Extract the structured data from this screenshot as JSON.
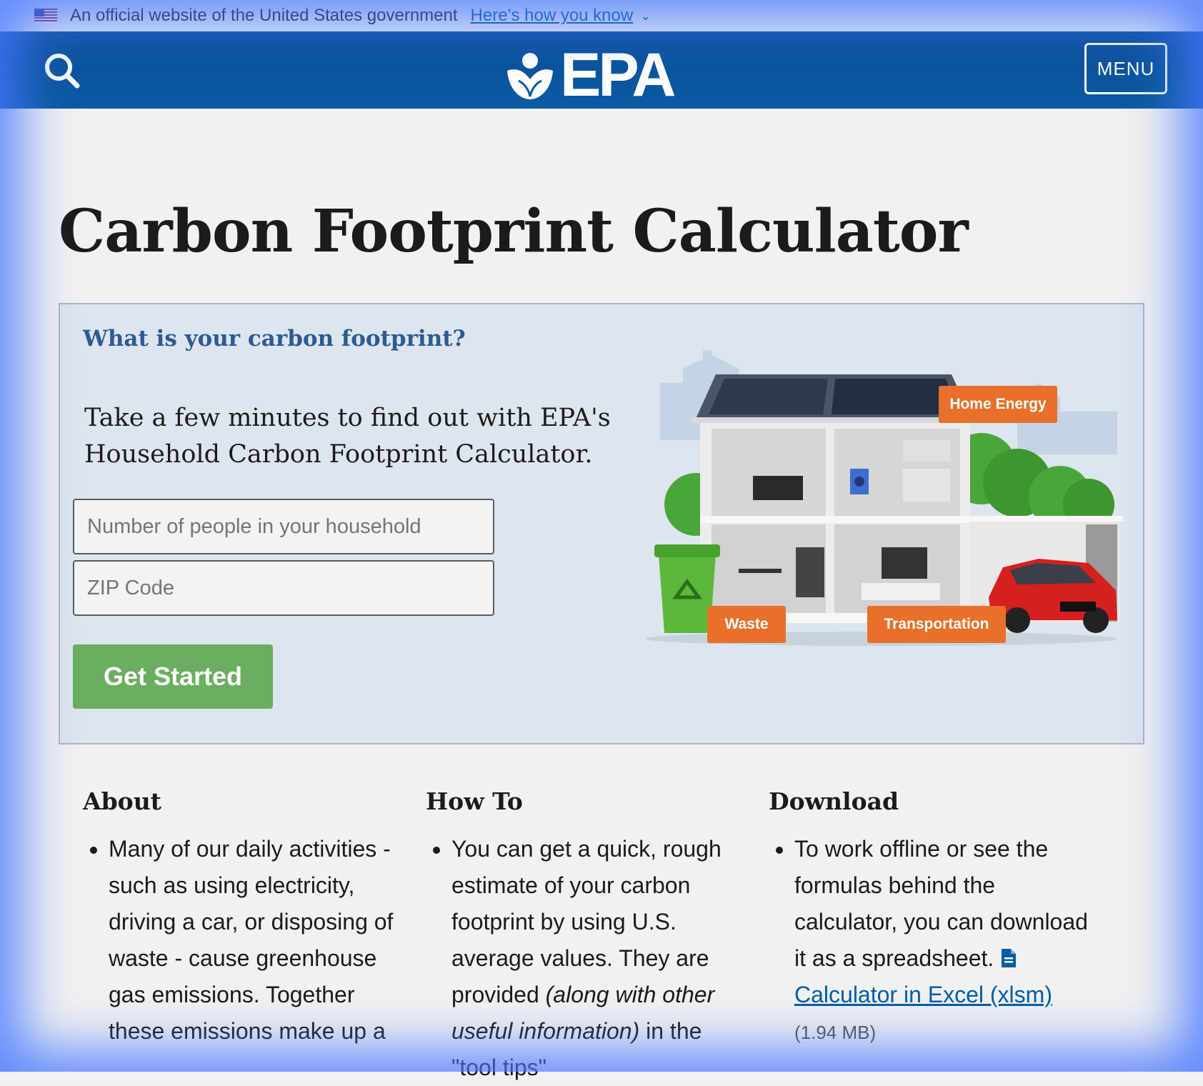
{
  "gov_banner": {
    "text": "An official website of the United States government",
    "link": "Here’s how you know"
  },
  "header": {
    "logo_text": "EPA",
    "menu_label": "MENU"
  },
  "page": {
    "title": "Carbon Footprint Calculator"
  },
  "hero": {
    "question": "What is your carbon footprint?",
    "intro": "Take a few minutes to find out with EPA's Household Carbon Footprint Calculator.",
    "people_placeholder": "Number of people in your household",
    "zip_placeholder": "ZIP Code",
    "start_label": "Get Started",
    "tags": {
      "home": "Home Energy",
      "waste": "Waste",
      "transport": "Transportation"
    }
  },
  "columns": {
    "about": {
      "heading": "About",
      "text": "Many of our daily activities - such as using electricity, driving a car, or disposing of waste - cause greenhouse gas emissions. Together these emissions make up a"
    },
    "howto": {
      "heading": "How To",
      "text_a": "You can get a quick, rough estimate of your carbon footprint by using U.S. average values. They are provided ",
      "text_italic": "(along with other useful information)",
      "text_b": " in the \"tool tips\""
    },
    "download": {
      "heading": "Download",
      "text": "To work offline or see the formulas behind the calculator, you can download it as a spreadsheet. ",
      "link": "Calculator in Excel (xlsm)",
      "size": "(1.94 MB)"
    }
  }
}
